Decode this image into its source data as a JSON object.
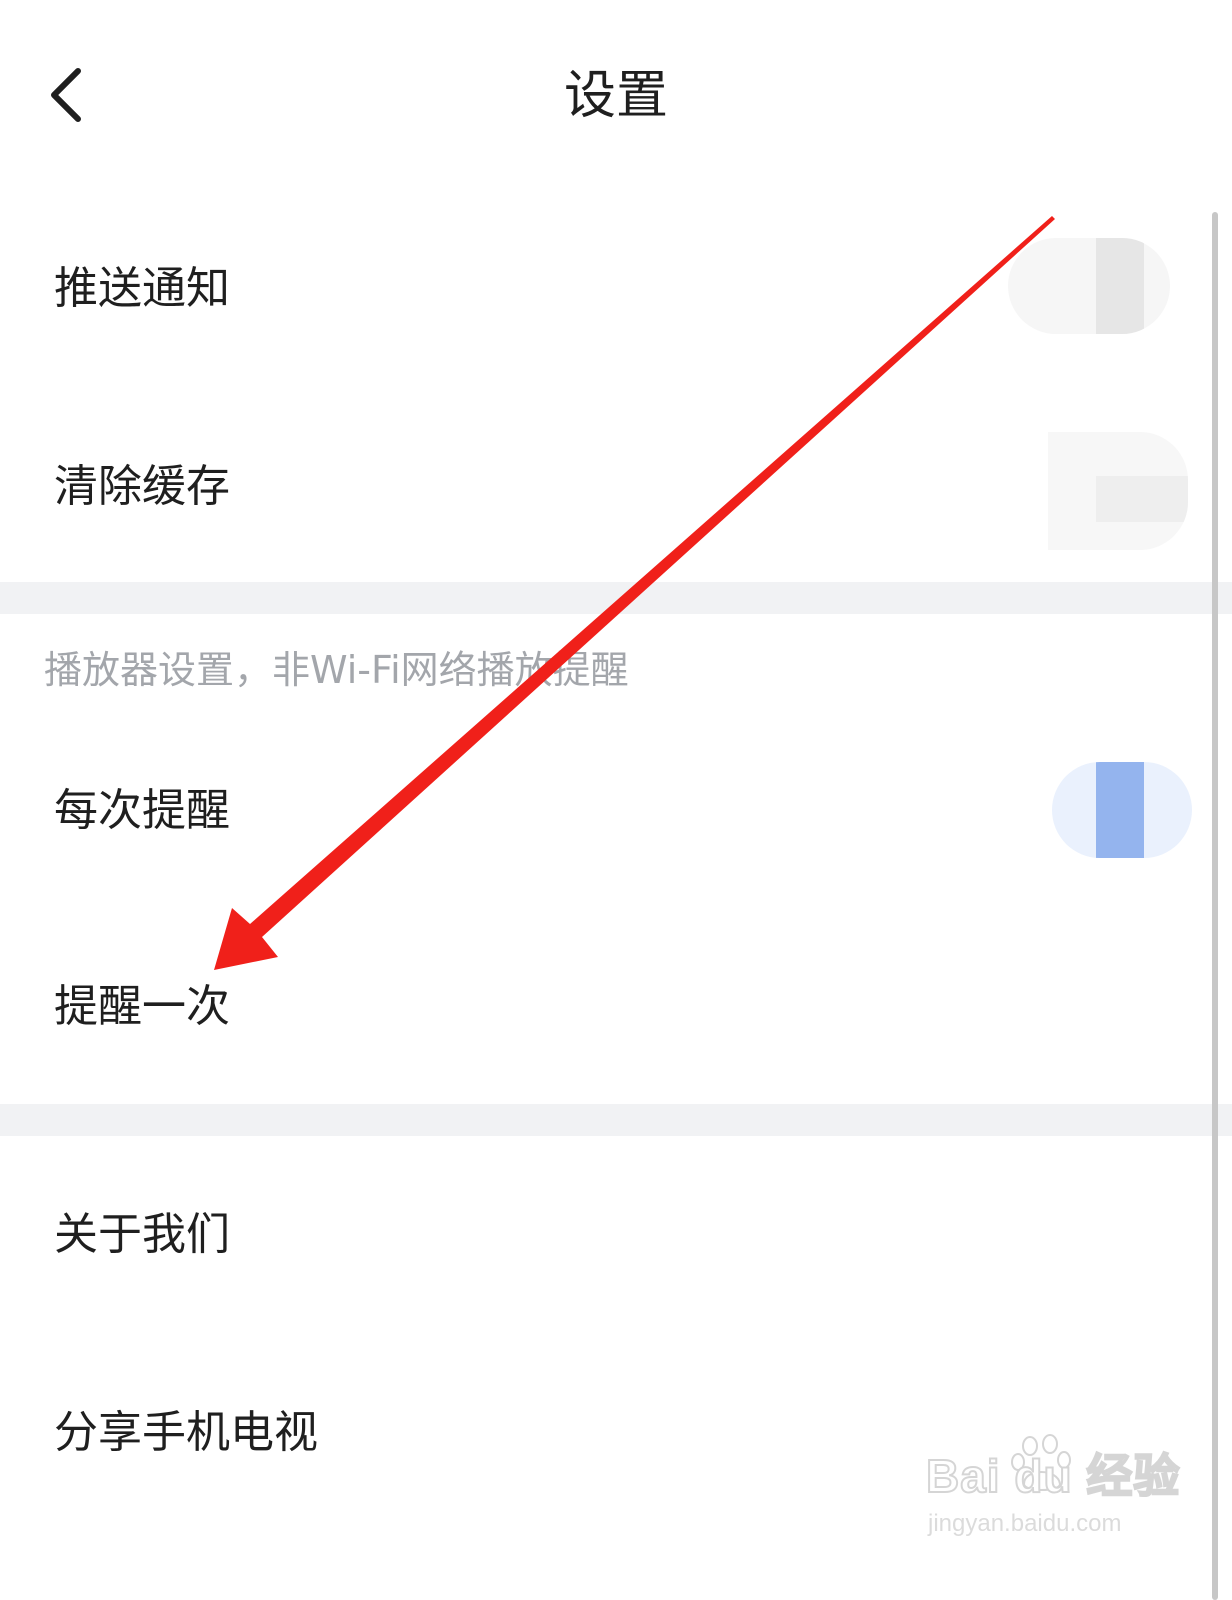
{
  "header": {
    "back_icon": "chevron-left-icon",
    "title": "设置"
  },
  "general": {
    "items": [
      {
        "label": "推送通知"
      },
      {
        "label": "清除缓存"
      }
    ]
  },
  "player": {
    "caption": "播放器设置，非Wi-Fi网络播放提醒",
    "items": [
      {
        "label": "每次提醒"
      },
      {
        "label": "提醒一次"
      }
    ]
  },
  "about": {
    "items": [
      {
        "label": "关于我们"
      },
      {
        "label": "分享手机电视"
      }
    ]
  },
  "annotation": {
    "arrow_color": "#f0201a"
  },
  "watermark": {
    "logo_text": "Bai du 经验",
    "url": "jingyan.baidu.com"
  },
  "colors": {
    "separator": "#f1f2f4",
    "caption": "#a3a6ab",
    "accent_blue": "#94b4ee"
  }
}
